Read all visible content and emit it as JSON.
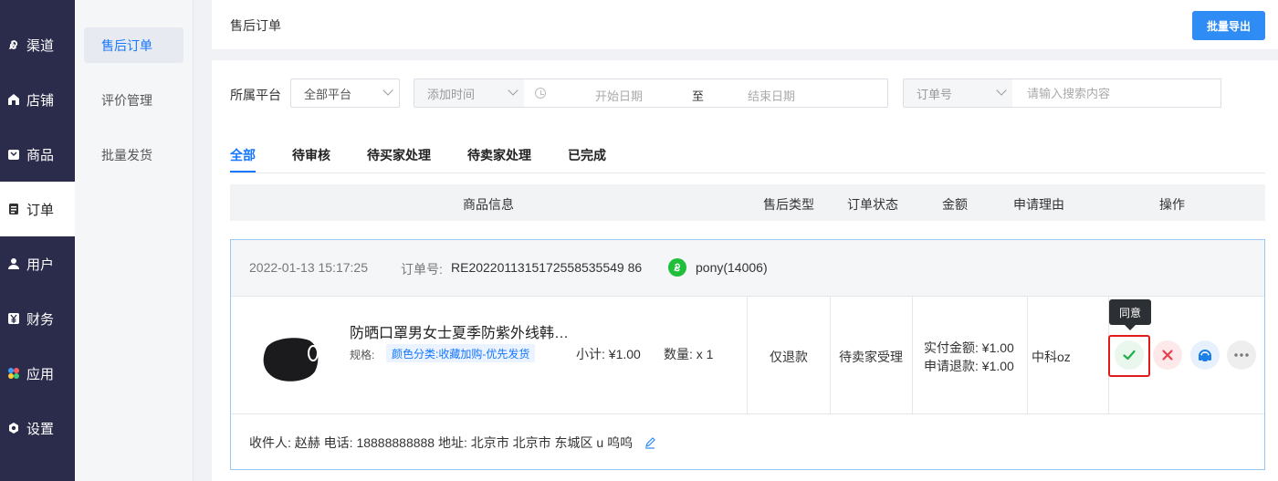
{
  "nav": {
    "items": [
      {
        "label": "渠道",
        "icon": "link-icon"
      },
      {
        "label": "店铺",
        "icon": "store-icon"
      },
      {
        "label": "商品",
        "icon": "box-icon"
      },
      {
        "label": "订单",
        "icon": "clipboard-icon"
      },
      {
        "label": "用户",
        "icon": "user-icon"
      },
      {
        "label": "财务",
        "icon": "yen-icon"
      },
      {
        "label": "应用",
        "icon": "apps-icon"
      },
      {
        "label": "设置",
        "icon": "gear-icon"
      }
    ],
    "active_index": 3
  },
  "subnav": {
    "items": [
      {
        "label": "售后订单"
      },
      {
        "label": "评价管理"
      },
      {
        "label": "批量发货"
      }
    ],
    "active_index": 0
  },
  "header": {
    "title": "售后订单",
    "export_label": "批量导出"
  },
  "filters": {
    "platform_label": "所属平台",
    "platform_value": "全部平台",
    "time_type": "添加时间",
    "start_placeholder": "开始日期",
    "to_label": "至",
    "end_placeholder": "结束日期",
    "search_type": "订单号",
    "search_placeholder": "请输入搜索内容"
  },
  "tabs": [
    {
      "label": "全部"
    },
    {
      "label": "待审核"
    },
    {
      "label": "待买家处理"
    },
    {
      "label": "待卖家处理"
    },
    {
      "label": "已完成"
    }
  ],
  "table": {
    "headers": [
      "商品信息",
      "售后类型",
      "订单状态",
      "金额",
      "申请理由",
      "操作"
    ]
  },
  "order": {
    "time": "2022-01-13 15:17:25",
    "order_no_label": "订单号:",
    "order_no": "RE2022011315172558535549 86",
    "buyer": "pony(14006)",
    "product_name": "防晒口罩男女士夏季防紫外线韩…",
    "spec_label": "规格:",
    "spec_value": "颜色分类:收藏加购-优先发货",
    "subtotal": "小计: ¥1.00",
    "quantity": "数量: x 1",
    "aftersale_type": "仅退款",
    "status": "待卖家受理",
    "paid": "实付金额: ¥1.00",
    "refund": "申请退款: ¥1.00",
    "reason": "中科oz",
    "tooltip": "同意",
    "receiver": "收件人: 赵赫 电话: 18888888888 地址: 北京市 北京市 东城区 u 呜呜"
  },
  "colors": {
    "accent": "#1677ff",
    "nav_bg": "#2b2c4b",
    "export_btn": "#2f8cf5",
    "agree": "#21b04b",
    "reject": "#e8414d",
    "highlight": "#e01b1b"
  }
}
